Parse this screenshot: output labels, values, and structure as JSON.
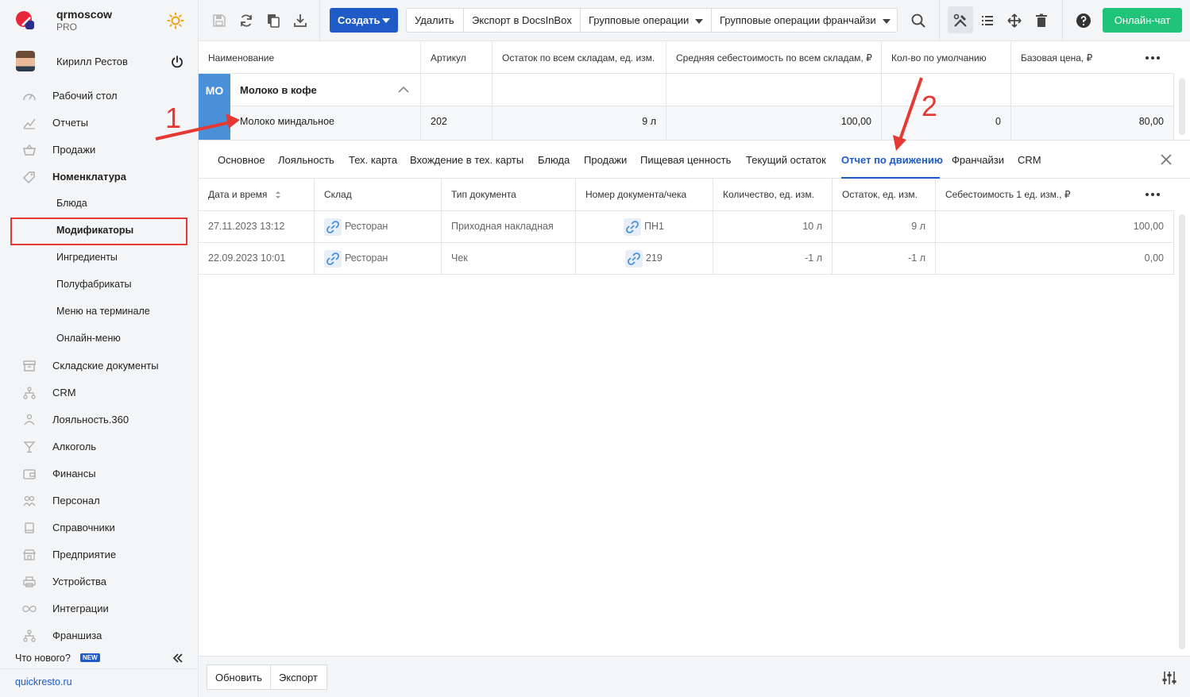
{
  "brand": {
    "name": "qrmoscow",
    "plan": "PRO"
  },
  "user": {
    "name": "Кирилл Рестов"
  },
  "sidebar": {
    "items": [
      {
        "label": "Рабочий стол",
        "icon": "dashboard-icon"
      },
      {
        "label": "Отчеты",
        "icon": "chart-icon"
      },
      {
        "label": "Продажи",
        "icon": "basket-icon"
      },
      {
        "label": "Номенклатура",
        "icon": "tag-icon"
      },
      {
        "label": "Складские документы",
        "icon": "archive-icon"
      },
      {
        "label": "CRM",
        "icon": "hierarchy-icon"
      },
      {
        "label": "Лояльность.360",
        "icon": "loyalty-icon"
      },
      {
        "label": "Алкоголь",
        "icon": "glass-icon"
      },
      {
        "label": "Финансы",
        "icon": "wallet-icon"
      },
      {
        "label": "Персонал",
        "icon": "people-icon"
      },
      {
        "label": "Справочники",
        "icon": "book-icon"
      },
      {
        "label": "Предприятие",
        "icon": "store-icon"
      },
      {
        "label": "Устройства",
        "icon": "printer-icon"
      },
      {
        "label": "Интеграции",
        "icon": "infinity-icon"
      },
      {
        "label": "Франшиза",
        "icon": "franchise-icon"
      }
    ],
    "subitems": [
      {
        "label": "Блюда"
      },
      {
        "label": "Модификаторы"
      },
      {
        "label": "Ингредиенты"
      },
      {
        "label": "Полуфабрикаты"
      },
      {
        "label": "Меню на терминале"
      },
      {
        "label": "Онлайн-меню"
      }
    ],
    "whats_new": "Что нового?",
    "new_badge": "NEW",
    "site": "quickresto.ru"
  },
  "toolbar": {
    "create": "Создать",
    "delete": "Удалить",
    "export_docs": "Экспорт в DocsInBox",
    "group_ops": "Групповые операции",
    "group_ops_franchise": "Групповые операции франчайзи",
    "chat": "Онлайн-чат"
  },
  "grid": {
    "columns": [
      "Наименование",
      "Артикул",
      "Остаток по всем складам, ед. изм.",
      "Средняя себестоимость по всем складам, ₽",
      "Кол-во по умолчанию",
      "Базовая цена, ₽"
    ],
    "group": {
      "badge": "МО",
      "name": "Молоко в кофе"
    },
    "row": {
      "name": "Молоко миндальное",
      "article": "202",
      "stock": "9 л",
      "avg_cost": "100,00",
      "default_qty": "0",
      "base_price": "80,00"
    }
  },
  "tabs": [
    "Основное",
    "Лояльность",
    "Тех. карта",
    "Вхождение в тех. карты",
    "Блюда",
    "Продажи",
    "Пищевая ценность",
    "Текущий остаток",
    "Отчет по движению",
    "Франчайзи",
    "CRM"
  ],
  "movement": {
    "columns": [
      "Дата и время",
      "Склад",
      "Тип документа",
      "Номер документа/чека",
      "Количество, ед. изм.",
      "Остаток, ед. изм.",
      "Себестоимость 1 ед. изм., ₽"
    ],
    "rows": [
      {
        "datetime": "27.11.2023 13:12",
        "warehouse": "Ресторан",
        "doc_type": "Приходная накладная",
        "doc_number": "ПН1",
        "qty": "10 л",
        "balance": "9 л",
        "unit_cost": "100,00"
      },
      {
        "datetime": "22.09.2023 10:01",
        "warehouse": "Ресторан",
        "doc_type": "Чек",
        "doc_number": "219",
        "qty": "-1 л",
        "balance": "-1 л",
        "unit_cost": "0,00"
      }
    ]
  },
  "footer": {
    "refresh": "Обновить",
    "export": "Экспорт"
  },
  "annotations": {
    "one": "1",
    "two": "2"
  },
  "colors": {
    "accent": "#1e5bc6",
    "chat": "#1fc47a",
    "annotation": "#e53935",
    "group_badge": "#4a90d9"
  }
}
